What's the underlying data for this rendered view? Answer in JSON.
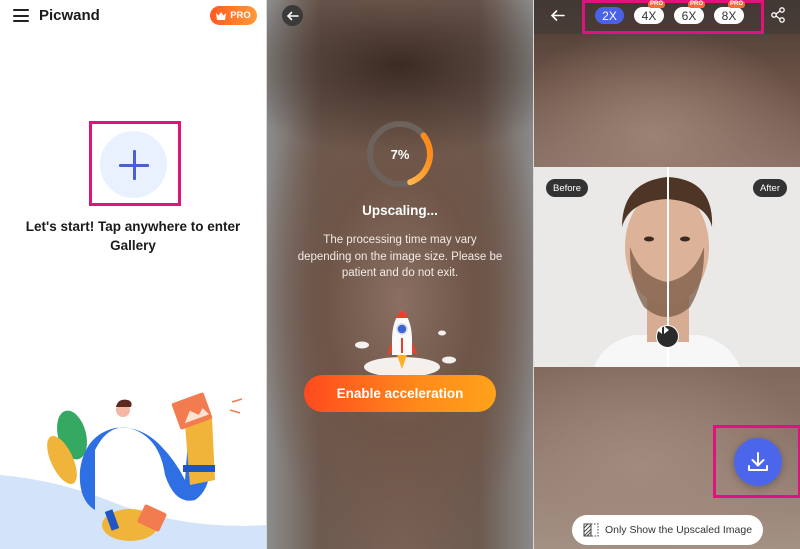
{
  "home": {
    "app_title": "Picwand",
    "pro_badge": "PRO",
    "start_prompt": "Let's start! Tap anywhere to enter Gallery",
    "icons": {
      "menu": "hamburger-menu-icon",
      "crown": "crown-icon",
      "add": "plus-icon"
    }
  },
  "processing": {
    "progress_percent": 7,
    "progress_label": "7%",
    "title": "Upscaling...",
    "description": "The processing time may vary depending on the image size. Please be patient and do not exit.",
    "accelerate_label": "Enable acceleration",
    "icons": {
      "back": "arrow-left-icon",
      "rocket": "rocket-icon"
    }
  },
  "result": {
    "scales": [
      {
        "label": "2X",
        "active": true,
        "pro": false
      },
      {
        "label": "4X",
        "active": false,
        "pro": true,
        "pro_tag": "PRO"
      },
      {
        "label": "6X",
        "active": false,
        "pro": true,
        "pro_tag": "PRO"
      },
      {
        "label": "8X",
        "active": false,
        "pro": true,
        "pro_tag": "PRO"
      }
    ],
    "before_label": "Before",
    "after_label": "After",
    "only_show_label": "Only Show the Upscaled Image",
    "icons": {
      "back": "arrow-left-icon",
      "share": "share-icon",
      "download": "download-icon",
      "compare_handle": "split-handle-icon",
      "only_show": "compare-split-icon"
    }
  },
  "colors": {
    "brand_blue": "#4a63e6",
    "accent_orange": "#ff7a1a",
    "highlight_magenta": "#e0137c",
    "progress_ring": "#ffb020"
  }
}
